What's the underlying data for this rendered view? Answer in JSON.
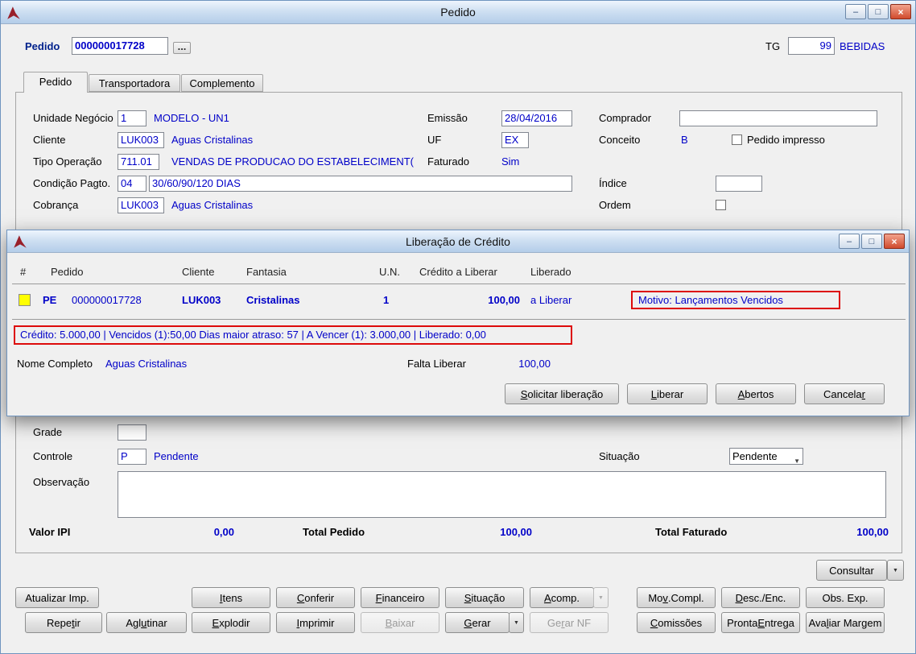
{
  "colors": {
    "value_blue": "#0000c8",
    "alert_red": "#dd0b0b",
    "flag_yellow": "#ffff00"
  },
  "icons": {
    "minimize": "–",
    "maximize": "□",
    "close": "×",
    "dropdown": "▼",
    "combo_arrow": "▼",
    "ellipsis": "..."
  },
  "main": {
    "title": "Pedido",
    "header": {
      "pedido_label": "Pedido",
      "pedido_value": "000000017728",
      "tg_label": "TG",
      "tg_value": "99",
      "tg_desc": "BEBIDAS"
    },
    "tabs": [
      {
        "label": "Pedido"
      },
      {
        "label": "Transportadora"
      },
      {
        "label": "Complemento"
      }
    ],
    "form": {
      "unidade_negocio": {
        "label": "Unidade Negócio",
        "code": "1",
        "desc": "MODELO - UN1"
      },
      "emissao": {
        "label": "Emissão",
        "value": "28/04/2016"
      },
      "comprador": {
        "label": "Comprador",
        "value": ""
      },
      "cliente": {
        "label": "Cliente",
        "code": "LUK003",
        "desc": "Aguas Cristalinas"
      },
      "uf": {
        "label": "UF",
        "value": "EX"
      },
      "conceito": {
        "label": "Conceito",
        "value": "B"
      },
      "pedido_impresso": {
        "label": "Pedido impresso"
      },
      "tipo_operacao": {
        "label": "Tipo Operação",
        "code": "711.01",
        "desc": "VENDAS DE PRODUCAO DO ESTABELECIMENT("
      },
      "faturado": {
        "label": "Faturado",
        "value": "Sim"
      },
      "condicao_pagto": {
        "label": "Condição Pagto.",
        "code": "04",
        "desc": "30/60/90/120 DIAS"
      },
      "indice": {
        "label": "Índice",
        "value": ""
      },
      "cobranca": {
        "label": "Cobrança",
        "code": "LUK003",
        "desc": "Aguas Cristalinas"
      },
      "ordem": {
        "label": "Ordem"
      },
      "grade": {
        "label": "Grade",
        "value": ""
      },
      "controle": {
        "label": "Controle",
        "code": "P",
        "desc": "Pendente"
      },
      "situacao": {
        "label": "Situação",
        "value": "Pendente"
      },
      "observacao": {
        "label": "Observação",
        "value": ""
      }
    },
    "totals": {
      "valor_ipi_label": "Valor IPI",
      "valor_ipi_value": "0,00",
      "total_pedido_label": "Total Pedido",
      "total_pedido_value": "100,00",
      "total_faturado_label": "Total Faturado",
      "total_faturado_value": "100,00"
    },
    "consultar": {
      "label": "Consultar",
      "u": -1
    }
  },
  "dialog": {
    "title": "Liberação de Crédito",
    "columns": [
      "#",
      "Pedido",
      "Cliente",
      "Fantasia",
      "U.N.",
      "Crédito a Liberar",
      "Liberado"
    ],
    "row": {
      "tipo": "PE",
      "pedido": "000000017728",
      "cliente": "LUK003",
      "fantasia": "Cristalinas",
      "un": "1",
      "credito_a_liberar": "100,00",
      "liberado": "a Liberar",
      "motivo": "Motivo: Lançamentos Vencidos"
    },
    "credit_summary": "Crédito: 5.000,00 | Vencidos (1):50,00 Dias maior atraso: 57 | A Vencer (1): 3.000,00 | Liberado: 0,00",
    "nome_completo_label": "Nome Completo",
    "nome_completo_value": "Aguas Cristalinas",
    "falta_liberar_label": "Falta Liberar",
    "falta_liberar_value": "100,00",
    "buttons": [
      {
        "label": "Solicitar liberação",
        "u": 0
      },
      {
        "label": "Liberar",
        "u": 0
      },
      {
        "label": "Abertos",
        "u": 0
      },
      {
        "label": "Cancelar",
        "u": 7
      }
    ]
  },
  "buttons": {
    "row1": [
      {
        "label": "Atualizar Imp.",
        "u": -1
      },
      {
        "label": "Itens",
        "u": 0
      },
      {
        "label": "Conferir",
        "u": 0
      },
      {
        "label": "Financeiro",
        "u": 0
      },
      {
        "label": "Situação",
        "u": 0
      },
      {
        "label": "Acomp.",
        "u": 0
      },
      {
        "label": "Mov.Compl.",
        "u": 2
      },
      {
        "label": "Desc./Enc.",
        "u": 0
      },
      {
        "label": "Obs. Exp.",
        "u": -1
      }
    ],
    "row2": [
      {
        "label": "Repetir",
        "u": 4
      },
      {
        "label": "Aglutinar",
        "u": 3
      },
      {
        "label": "Explodir",
        "u": 0
      },
      {
        "label": "Imprimir",
        "u": 0
      },
      {
        "label": "Baixar",
        "u": 0,
        "disabled": true
      },
      {
        "label": "Gerar",
        "u": 0
      },
      {
        "label": "Gerar NF",
        "u": 2,
        "disabled": true
      },
      {
        "label": "Comissões",
        "u": 0
      },
      {
        "label": "Pronta Entrega",
        "u": 7
      },
      {
        "label": "Avaliar Margem",
        "u": 3
      }
    ]
  }
}
